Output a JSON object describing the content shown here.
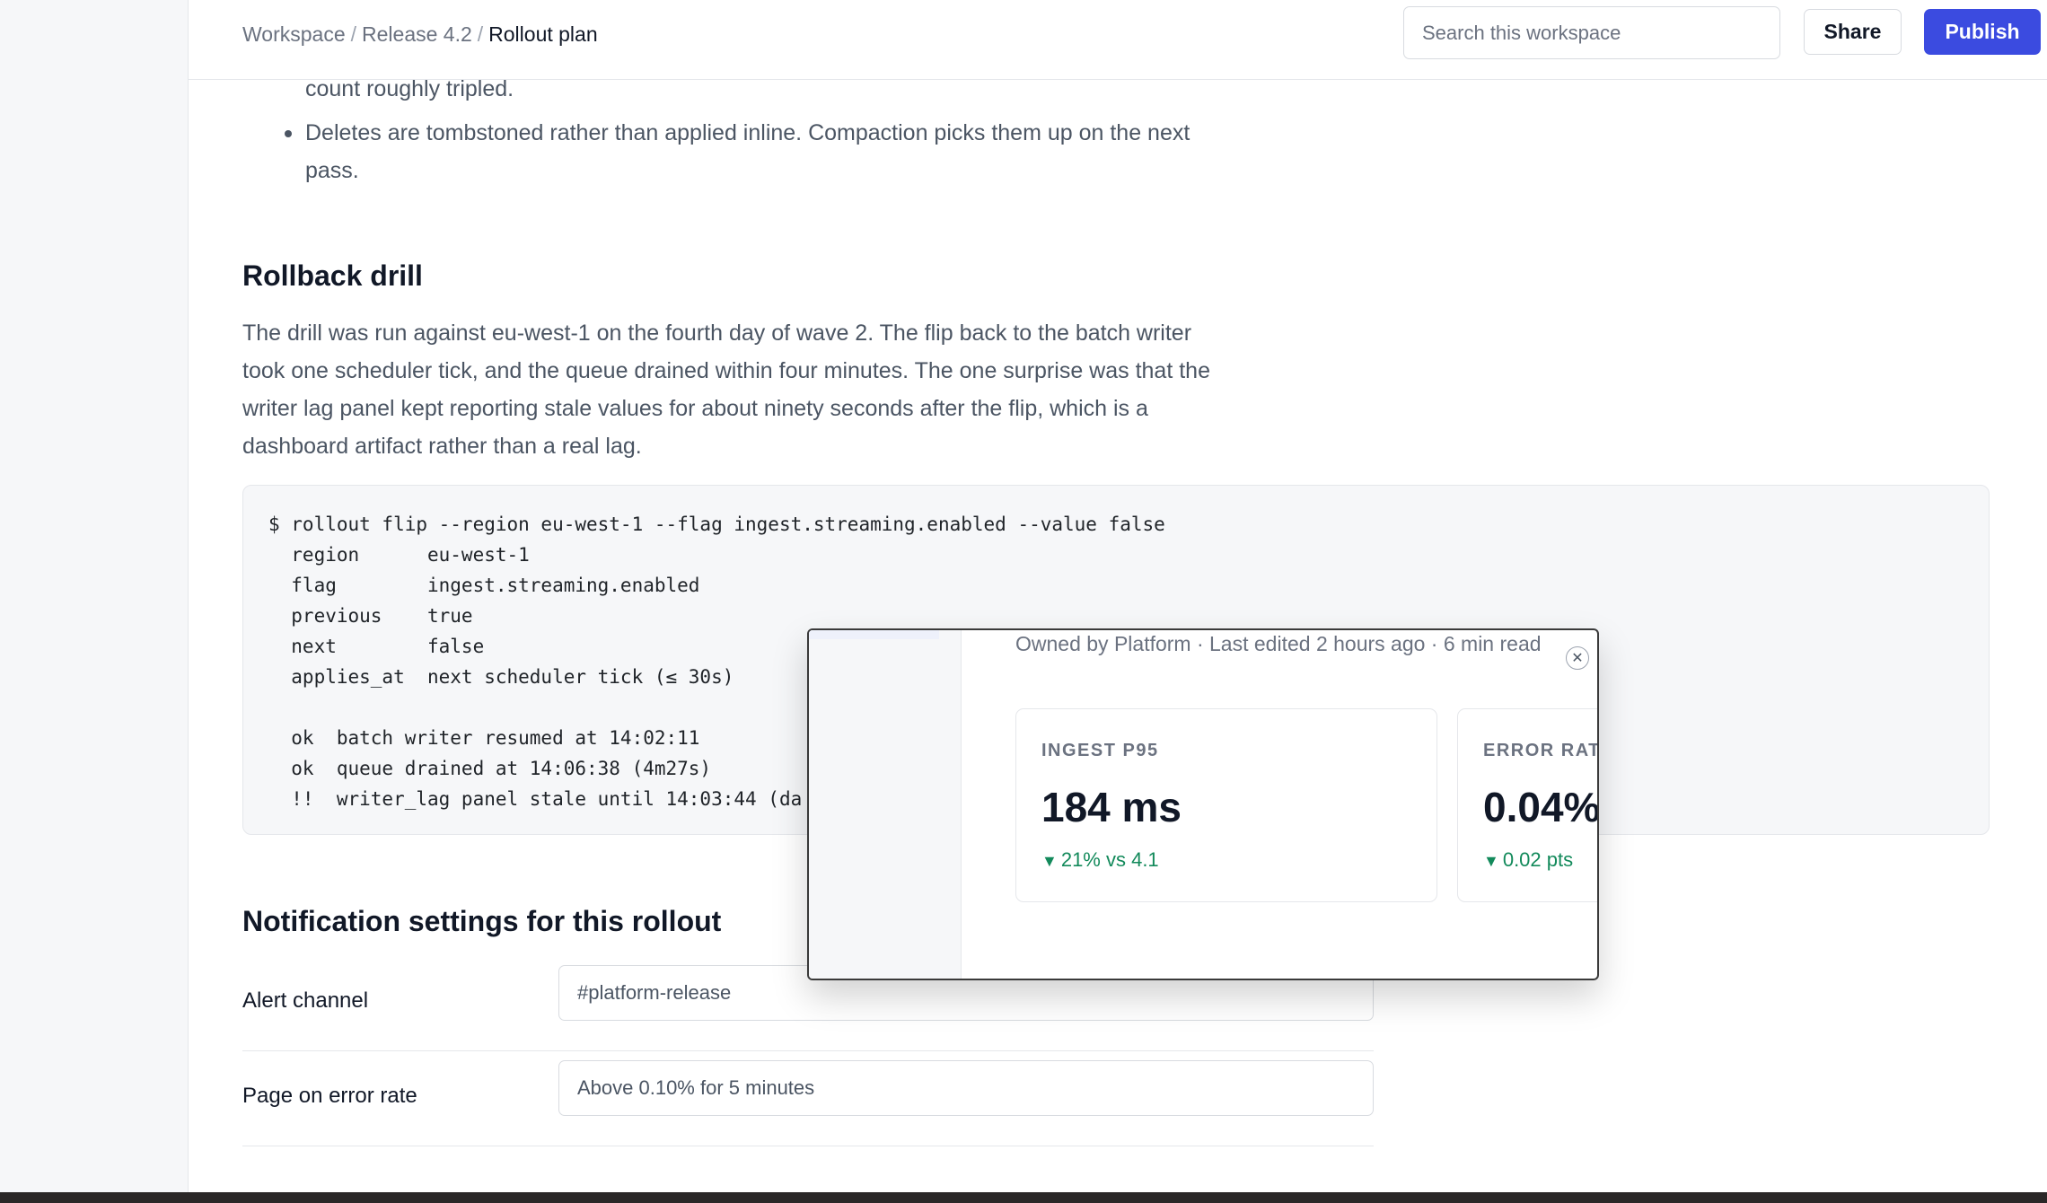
{
  "breadcrumb": {
    "workspace": "Workspace",
    "release": "Release 4.2",
    "current": "Rollout plan",
    "separator": "/"
  },
  "search": {
    "placeholder": "Search this workspace"
  },
  "actions": {
    "share": "Share",
    "publish": "Publish"
  },
  "colors": {
    "accent": "#3b4be0",
    "positive": "#138a5b"
  },
  "bullets": {
    "prev_fragment": "count roughly tripled.",
    "items": [
      "Deletes are tombstoned rather than applied inline. Compaction picks them up on the next pass."
    ]
  },
  "rollback": {
    "heading": "Rollback drill",
    "paragraph": "The drill was run against eu-west-1 on the fourth day of wave 2. The flip back to the batch writer took one scheduler tick, and the queue drained within four minutes. The one surprise was that the writer lag panel kept reporting stale values for about ninety seconds after the flip, which is a dashboard artifact rather than a real lag.",
    "code": "$ rollout flip --region eu-west-1 --flag ingest.streaming.enabled --value false\n  region      eu-west-1\n  flag        ingest.streaming.enabled\n  previous    true\n  next        false\n  applies_at  next scheduler tick (≤ 30s)\n\n  ok  batch writer resumed at 14:02:11\n  ok  queue drained at 14:06:38 (4m27s)\n  !!  writer_lag panel stale until 14:03:44 (da"
  },
  "notifications": {
    "heading": "Notification settings for this rollout",
    "rows": [
      {
        "label": "Alert channel",
        "value": "#platform-release"
      },
      {
        "label": "Page on error rate",
        "value": "Above 0.10% for 5 minutes"
      }
    ]
  },
  "popup": {
    "meta": "Owned by Platform · Last edited 2 hours ago · 6 min read",
    "close_icon": "close-icon",
    "metrics": [
      {
        "label": "INGEST P95",
        "value": "184 ms",
        "delta": "21% vs 4.1",
        "trend": "down"
      },
      {
        "label": "ERROR RATE",
        "value": "0.04%",
        "delta": "0.02 pts",
        "trend": "down"
      }
    ]
  }
}
